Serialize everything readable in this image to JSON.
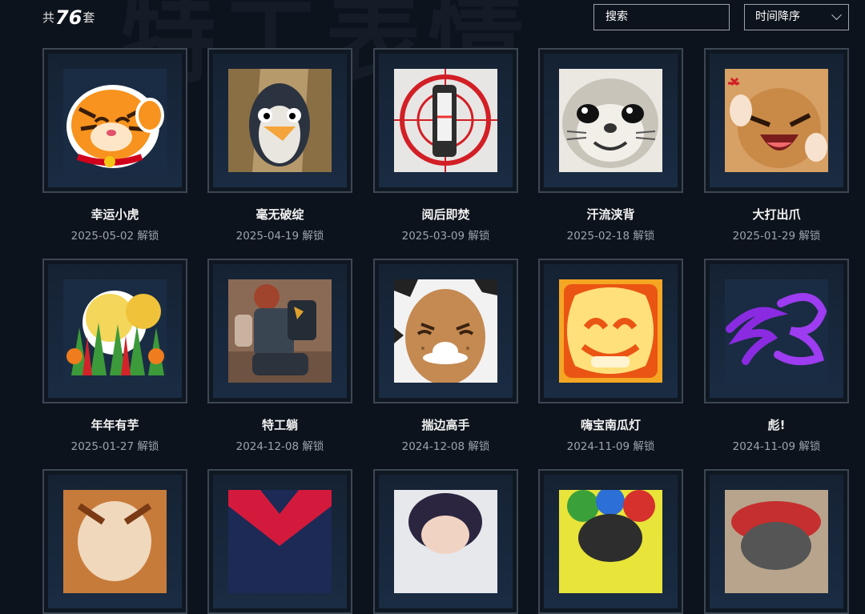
{
  "header": {
    "count_prefix": "共",
    "count": "76",
    "count_suffix": "套",
    "search_placeholder": "搜索",
    "sort_label": "时间降序"
  },
  "items": [
    {
      "name": "幸运小虎",
      "date": "2025-05-02 解锁",
      "icon": "tiger-sticker"
    },
    {
      "name": "毫无破绽",
      "date": "2025-04-19 解锁",
      "icon": "penguin-sticker"
    },
    {
      "name": "阅后即焚",
      "date": "2025-03-09 解锁",
      "icon": "target-sticker"
    },
    {
      "name": "汗流浃背",
      "date": "2025-02-18 解锁",
      "icon": "seal-sticker"
    },
    {
      "name": "大打出爪",
      "date": "2025-01-29 解锁",
      "icon": "angry-cat-sticker"
    },
    {
      "name": "年年有芋",
      "date": "2025-01-27 解锁",
      "icon": "vegetables-sticker"
    },
    {
      "name": "特工躺",
      "date": "2024-12-08 解锁",
      "icon": "agent-sticker"
    },
    {
      "name": "揣边高手",
      "date": "2024-12-08 解锁",
      "icon": "potato-sticker"
    },
    {
      "name": "嗨宝南瓜灯",
      "date": "2024-11-09 解锁",
      "icon": "pumpkin-sticker"
    },
    {
      "name": "彪!",
      "date": "2024-11-09 解锁",
      "icon": "purple-scribble-sticker"
    },
    {
      "name": "",
      "date": "",
      "icon": "sticker-partial-1"
    },
    {
      "name": "",
      "date": "",
      "icon": "sticker-partial-2"
    },
    {
      "name": "",
      "date": "",
      "icon": "sticker-partial-3"
    },
    {
      "name": "",
      "date": "",
      "icon": "sticker-partial-4"
    },
    {
      "name": "",
      "date": "",
      "icon": "sticker-partial-5"
    }
  ],
  "colors": {
    "background": "#0d131c",
    "card_border": "#3d4753",
    "card_inner": "#1a2c43",
    "date_text": "#9ba3ad"
  }
}
